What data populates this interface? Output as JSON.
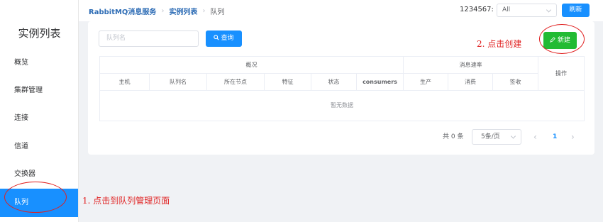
{
  "sidebar": {
    "title": "实例列表",
    "items": [
      {
        "label": "概览"
      },
      {
        "label": "集群管理"
      },
      {
        "label": "连接"
      },
      {
        "label": "信道"
      },
      {
        "label": "交换器"
      },
      {
        "label": "队列"
      }
    ]
  },
  "header": {
    "breadcrumb": [
      "RabbitMQ消息服务",
      "实例列表",
      "队列"
    ],
    "instance_label": "1234567:",
    "instance_select": "All",
    "refresh_label": "刷新"
  },
  "toolbar": {
    "search_placeholder": "队列名",
    "query_label": "查询",
    "create_label": "新建"
  },
  "table": {
    "groups": [
      "概况",
      "消息速率",
      "操作"
    ],
    "columns": [
      "主机",
      "队列名",
      "所在节点",
      "特征",
      "状态",
      "consumers",
      "生产",
      "消费",
      "签收"
    ],
    "empty_text": "暂无数据"
  },
  "pagination": {
    "total": "共 0 条",
    "page_size": "5条/页",
    "current_page": "1",
    "prev": "‹",
    "next": "›"
  },
  "annotations": {
    "step1": "1. 点击到队列管理页面",
    "step2": "2. 点击创建"
  },
  "colors": {
    "primary": "#1890ff",
    "create": "#22bb33",
    "annotation": "#e02020"
  }
}
